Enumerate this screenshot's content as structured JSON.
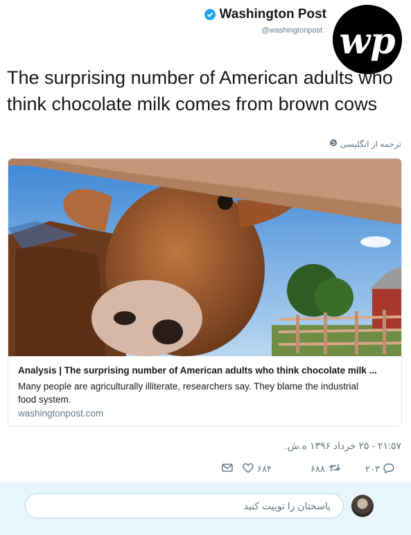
{
  "author": {
    "name": "Washington Post",
    "handle": "@washingtonpost",
    "verified": true
  },
  "tweet": {
    "text": "The surprising number of American adults who think chocolate milk comes from brown cows",
    "translate_label": "ترجمه از انگلیسی",
    "timestamp": "۲۱:۵۷ - ۲۵ خرداد ۱۳۹۶ ه.ش."
  },
  "card": {
    "title": "Analysis | The surprising number of American adults who think chocolate milk ...",
    "description": "Many people are agriculturally illiterate, researchers say. They blame the industrial food system.",
    "domain": "washingtonpost.com"
  },
  "actions": {
    "reply_count": "۲۰۳",
    "retweet_count": "۶۸۸",
    "like_count": "۶۸۴"
  },
  "reply": {
    "placeholder": "پاسختان را توییت کنید"
  },
  "colors": {
    "accent": "#1da1f2",
    "muted": "#657786",
    "reply_bar": "#e8f5fd"
  }
}
